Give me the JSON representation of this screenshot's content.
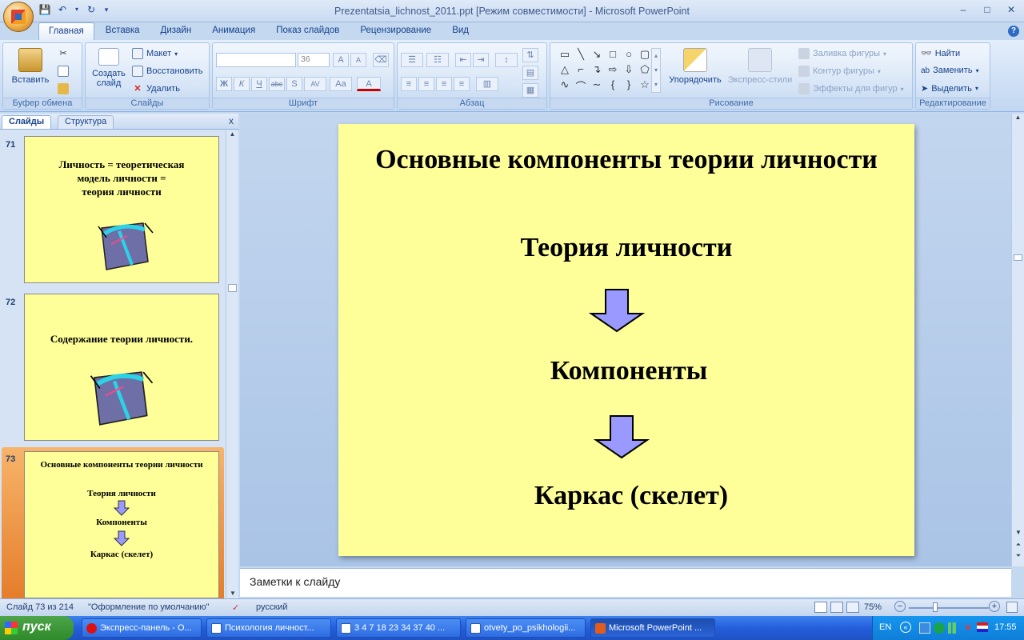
{
  "window": {
    "title": "Prezentatsia_lichnost_2011.ppt [Режим совместимости] - Microsoft PowerPoint",
    "controls": [
      "–",
      "□",
      "✕"
    ]
  },
  "ribbon": {
    "tabs": [
      "Главная",
      "Вставка",
      "Дизайн",
      "Анимация",
      "Показ слайдов",
      "Рецензирование",
      "Вид"
    ],
    "active_tab": "Главная",
    "clipboard": {
      "paste": "Вставить",
      "label": "Буфер обмена"
    },
    "slides": {
      "new_slide": "Создать слайд",
      "layout": "Макет",
      "reset": "Восстановить",
      "delete": "Удалить",
      "label": "Слайды"
    },
    "font": {
      "size": "36",
      "label": "Шрифт",
      "bold": "Ж",
      "italic": "К",
      "underline": "Ч",
      "strike": "abc",
      "shadow": "S",
      "spacing": "AV",
      "case": "Aa",
      "color": "A"
    },
    "paragraph": {
      "label": "Абзац"
    },
    "drawing": {
      "arrange": "Упорядочить",
      "quick_styles": "Экспресс-стили",
      "fill": "Заливка фигуры",
      "outline": "Контур фигуры",
      "effects": "Эффекты для фигур",
      "label": "Рисование"
    },
    "editing": {
      "find": "Найти",
      "replace": "Заменить",
      "select": "Выделить",
      "label": "Редактирование"
    }
  },
  "panel": {
    "tabs": [
      "Слайды",
      "Структура"
    ],
    "close": "x",
    "thumbnails": [
      {
        "num": "71",
        "text": [
          "Личность = теоретическая",
          "модель личности =",
          "теория личности"
        ]
      },
      {
        "num": "72",
        "text": [
          "Содержание теории личности."
        ]
      },
      {
        "num": "73",
        "title": "Основные компоненты теории личности",
        "items": [
          "Теория личности",
          "Компоненты",
          "Каркас (скелет)"
        ]
      }
    ]
  },
  "slide": {
    "title": "Основные компоненты теории личности",
    "items": [
      "Теория личности",
      "Компоненты",
      "Каркас (скелет)"
    ],
    "arrow_color": "#9999ff",
    "background": "#ffff99"
  },
  "notes": {
    "placeholder": "Заметки к слайду"
  },
  "status": {
    "slide": "Слайд 73 из 214",
    "theme": "\"Оформление по умолчанию\"",
    "language": "русский",
    "zoom": "75%"
  },
  "taskbar": {
    "start": "пуск",
    "tasks": [
      "Экспресс-панель - О...",
      "Психология личност...",
      "3 4 7 18 23 34 37 40 ...",
      "otvety_po_psikhologii...",
      "Microsoft PowerPoint ..."
    ],
    "lang": "EN",
    "time": "17:55"
  }
}
